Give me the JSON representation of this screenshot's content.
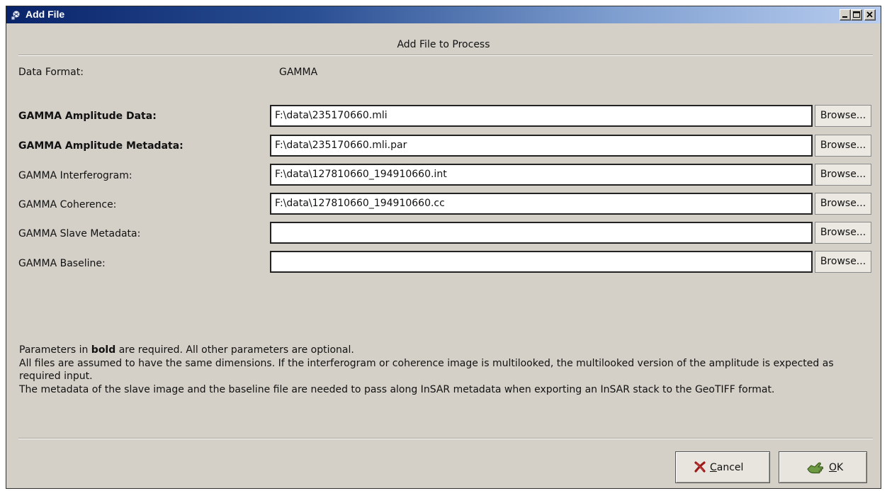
{
  "window": {
    "title": "Add File",
    "controls": {
      "minimize": "minimize-icon",
      "maximize": "maximize-icon",
      "close": "close-icon"
    }
  },
  "header": {
    "title": "Add File to Process"
  },
  "format": {
    "label": "Data Format:",
    "value": "GAMMA"
  },
  "fields": [
    {
      "label": "GAMMA Amplitude Data:",
      "value": "F:\\data\\235170660.mli",
      "required": true,
      "browse": "Browse..."
    },
    {
      "label": "GAMMA Amplitude Metadata:",
      "value": "F:\\data\\235170660.mli.par",
      "required": true,
      "browse": "Browse..."
    },
    {
      "label": "GAMMA Interferogram:",
      "value": "F:\\data\\127810660_194910660.int",
      "required": false,
      "browse": "Browse..."
    },
    {
      "label": "GAMMA Coherence:",
      "value": "F:\\data\\127810660_194910660.cc",
      "required": false,
      "browse": "Browse..."
    },
    {
      "label": "GAMMA Slave Metadata:",
      "value": "",
      "required": false,
      "browse": "Browse..."
    },
    {
      "label": "GAMMA Baseline:",
      "value": "",
      "required": false,
      "browse": "Browse..."
    }
  ],
  "notes": {
    "line1_prefix": "Parameters in ",
    "line1_bold": "bold",
    "line1_suffix": " are required. All other parameters are optional.",
    "line2": "All files are assumed to have the same dimensions. If the interferogram or coherence image is multilooked, the multilooked version of the amplitude is expected as required input.",
    "line3": "The metadata of the slave image and the baseline file are needed to pass along InSAR metadata when exporting an InSAR stack to the GeoTIFF format."
  },
  "buttons": {
    "cancel": {
      "label": "Cancel",
      "icon": "x-icon"
    },
    "ok": {
      "label": "OK",
      "icon": "ok-hand-icon"
    }
  },
  "colors": {
    "titlebar_start": "#0a246a",
    "titlebar_end": "#b8cdef",
    "dialog_bg": "#d4d0c8",
    "cancel_icon": "#9b1a1a"
  }
}
